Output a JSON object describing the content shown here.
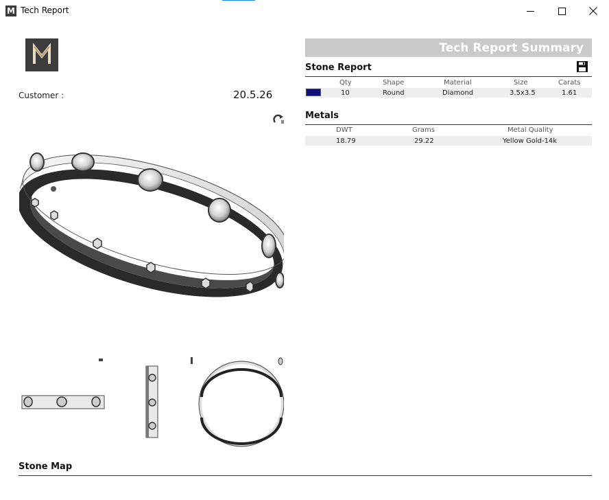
{
  "window": {
    "title": "Tech Report",
    "app_icon_letter": "M"
  },
  "logo": {
    "letter": "M",
    "bg": "#3c3c3c",
    "letter_color": "#d8cdb3"
  },
  "customer": {
    "label": "Customer :",
    "date": "20.5.26"
  },
  "summary": {
    "title": "Tech Report Summary"
  },
  "stone_report": {
    "title": "Stone Report",
    "headers": [
      "Qty",
      "Shape",
      "Material",
      "Size",
      "Carats"
    ],
    "rows": [
      {
        "color": "#10107a",
        "qty": "10",
        "shape": "Round",
        "material": "Diamond",
        "size": "3.5x3.5",
        "carats": "1.61"
      }
    ]
  },
  "metals": {
    "title": "Metals",
    "headers": [
      "DWT",
      "Grams",
      "Metal Quality"
    ],
    "rows": [
      {
        "dwt": "18.79",
        "grams": "29.22",
        "quality": "Yellow Gold-14k"
      }
    ]
  },
  "stone_map": {
    "title": "Stone Map"
  }
}
